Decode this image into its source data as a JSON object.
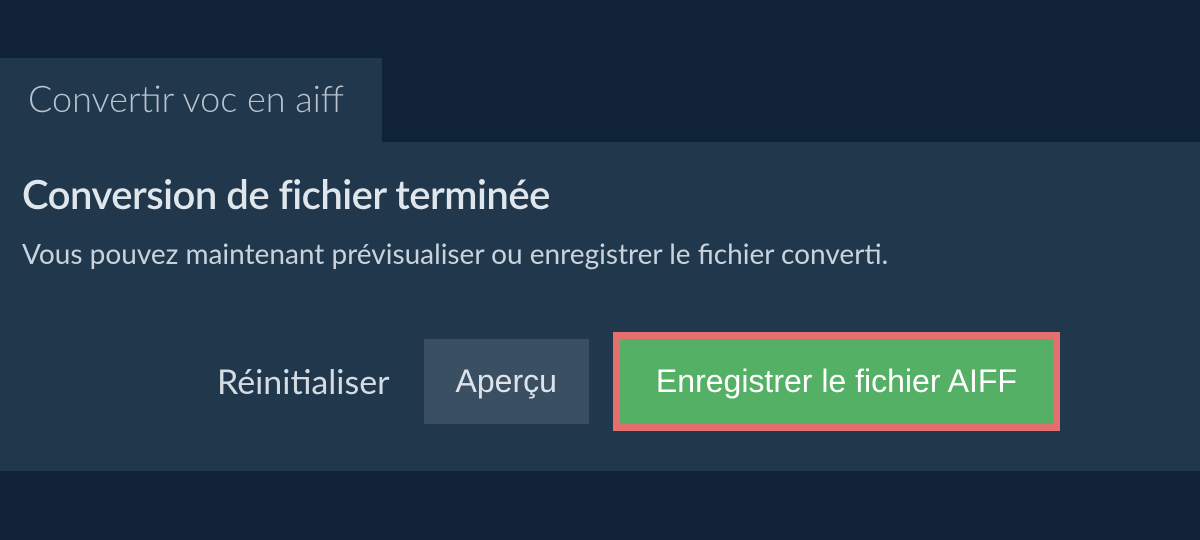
{
  "tab": {
    "label": "Convertir voc en aiff"
  },
  "panel": {
    "title": "Conversion de fichier terminée",
    "description": "Vous pouvez maintenant prévisualiser ou enregistrer le fichier converti."
  },
  "actions": {
    "reset_label": "Réinitialiser",
    "preview_label": "Aperçu",
    "save_label": "Enregistrer le fichier AIFF"
  }
}
